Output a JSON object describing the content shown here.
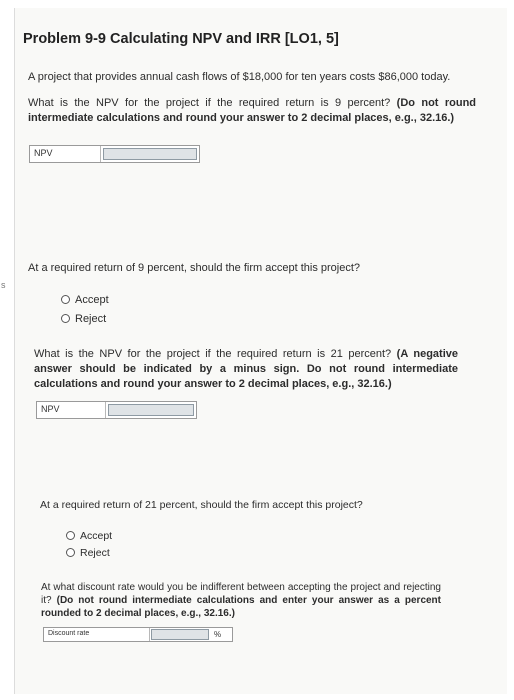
{
  "edge_mark": "s",
  "title": "Problem 9-9 Calculating NPV and IRR [LO1, 5]",
  "intro": "A project that provides annual cash flows of $18,000 for ten years costs $86,000 today.",
  "q1": {
    "text": "What is the NPV for the project if the required return is 9 percent?",
    "instruction": "(Do not round intermediate calculations and round your answer to 2 decimal places, e.g., 32.16.)",
    "field_label": "NPV",
    "field_value": ""
  },
  "q2": {
    "text": "At a required return of 9 percent, should the firm accept this project?",
    "options": [
      "Accept",
      "Reject"
    ]
  },
  "q3": {
    "text": "What is the NPV for the project if the required return is 21 percent?",
    "instruction": "(A negative answer should be indicated by a minus sign. Do not round intermediate calculations and round your answer to 2 decimal places, e.g., 32.16.)",
    "field_label": "NPV",
    "field_value": ""
  },
  "q4": {
    "text": "At a required return of 21 percent, should the firm accept this project?",
    "options": [
      "Accept",
      "Reject"
    ]
  },
  "q5": {
    "text": "At what discount rate would you be indifferent between accepting the project and rejecting it?",
    "instruction": "(Do not round intermediate calculations and enter your answer as a percent rounded to 2 decimal places, e.g., 32.16.)",
    "field_label": "Discount rate",
    "field_value": "",
    "unit": "%"
  }
}
